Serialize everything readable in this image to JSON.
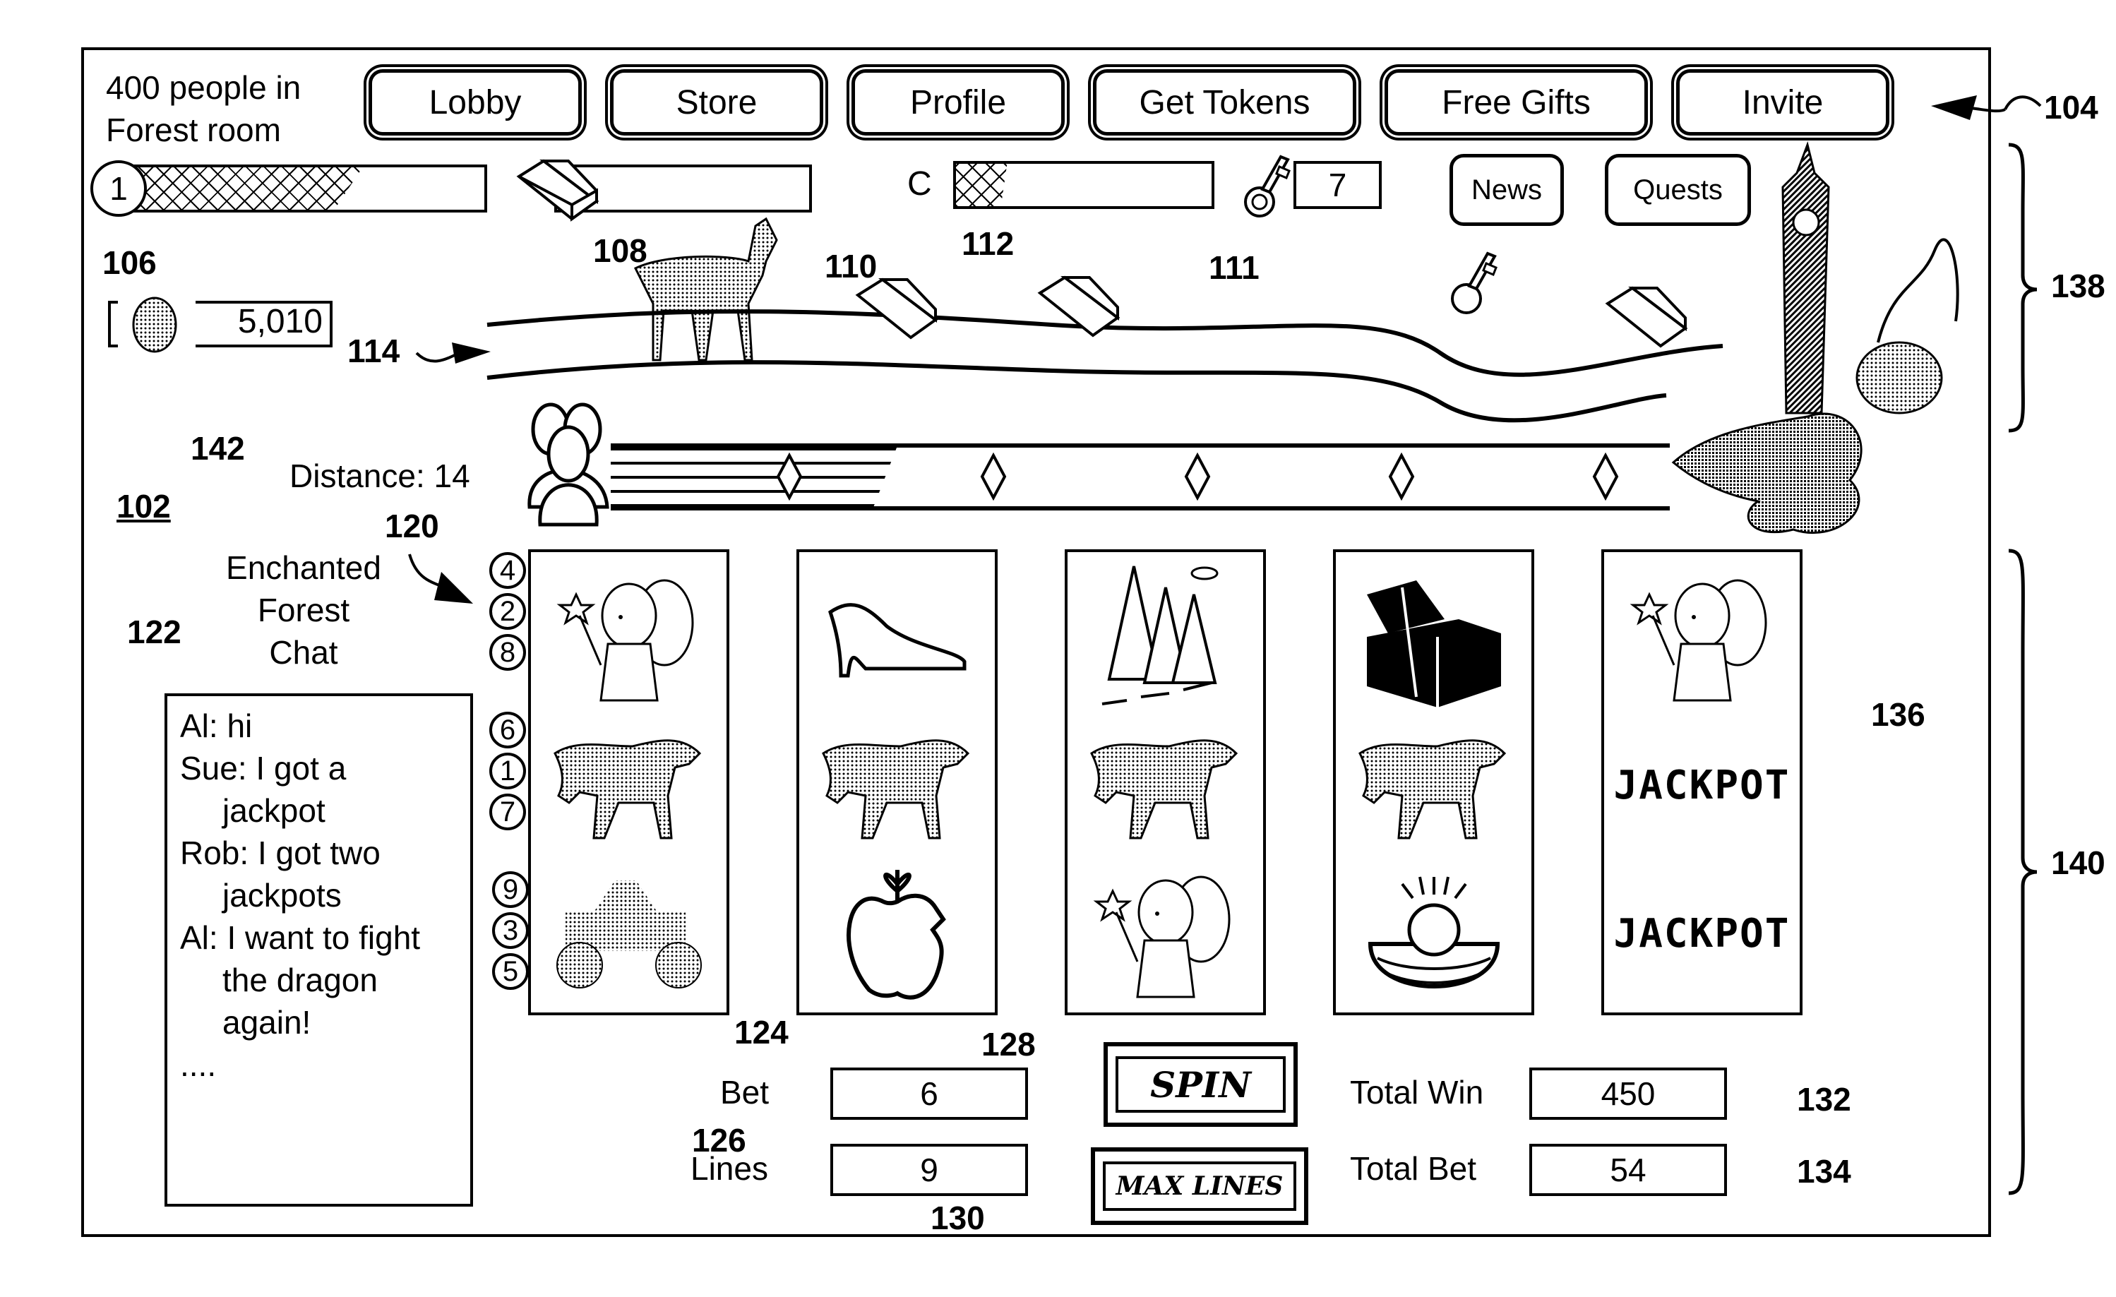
{
  "header": {
    "room_status_line1": "400 people in",
    "room_status_line2": "Forest room",
    "nav_buttons": [
      "Lobby",
      "Store",
      "Profile",
      "Get Tokens",
      "Free Gifts",
      "Invite"
    ]
  },
  "status_bar": {
    "level": "1",
    "level_progress": 0.66,
    "gold_bar_progress": 0.0,
    "collection_label": "C",
    "collection_progress": 0.2,
    "key_count": "7",
    "news_label": "News",
    "quests_label": "Quests",
    "coins": "5,010"
  },
  "quest_path": {
    "distance_label": "Distance: 14",
    "progress": 0.27,
    "milestones": 5
  },
  "chat": {
    "title_lines": [
      "Enchanted",
      "Forest",
      "Chat"
    ],
    "messages": [
      {
        "line": "Al: hi",
        "cont": []
      },
      {
        "line": "Sue: I got a",
        "cont": [
          "jackpot"
        ]
      },
      {
        "line": "Rob: I got two",
        "cont": [
          "jackpots"
        ]
      },
      {
        "line": "Al: I want to fight",
        "cont": [
          "the dragon",
          "again!"
        ]
      }
    ],
    "ellipsis": "...."
  },
  "slot": {
    "paylines_groups": [
      [
        "4",
        "2",
        "8"
      ],
      [
        "6",
        "1",
        "7"
      ],
      [
        "9",
        "3",
        "5"
      ]
    ],
    "reels": [
      [
        "fairy",
        "wolf",
        "carriage"
      ],
      [
        "glass-slipper",
        "wolf",
        "apple"
      ],
      [
        "pine-trees",
        "wolf",
        "fairy"
      ],
      [
        "treasure-chest",
        "wolf",
        "golden-egg-nest"
      ],
      [
        "fairy",
        "JACKPOT",
        "JACKPOT"
      ]
    ],
    "bet_label": "Bet",
    "bet_value": "6",
    "lines_label": "Lines",
    "lines_value": "9",
    "spin_label": "SPIN",
    "max_lines_label": "MAX LINES",
    "total_win_label": "Total Win",
    "total_win_value": "450",
    "total_bet_label": "Total Bet",
    "total_bet_value": "54"
  },
  "reference_numerals": {
    "r102": "102",
    "r104": "104",
    "r106": "106",
    "r108": "108",
    "r110": "110",
    "r111": "111",
    "r112": "112",
    "r114": "114",
    "r120": "120",
    "r122": "122",
    "r124": "124",
    "r126": "126",
    "r128": "128",
    "r130": "130",
    "r132": "132",
    "r134": "134",
    "r136": "136",
    "r138": "138",
    "r140": "140",
    "r142": "142"
  }
}
